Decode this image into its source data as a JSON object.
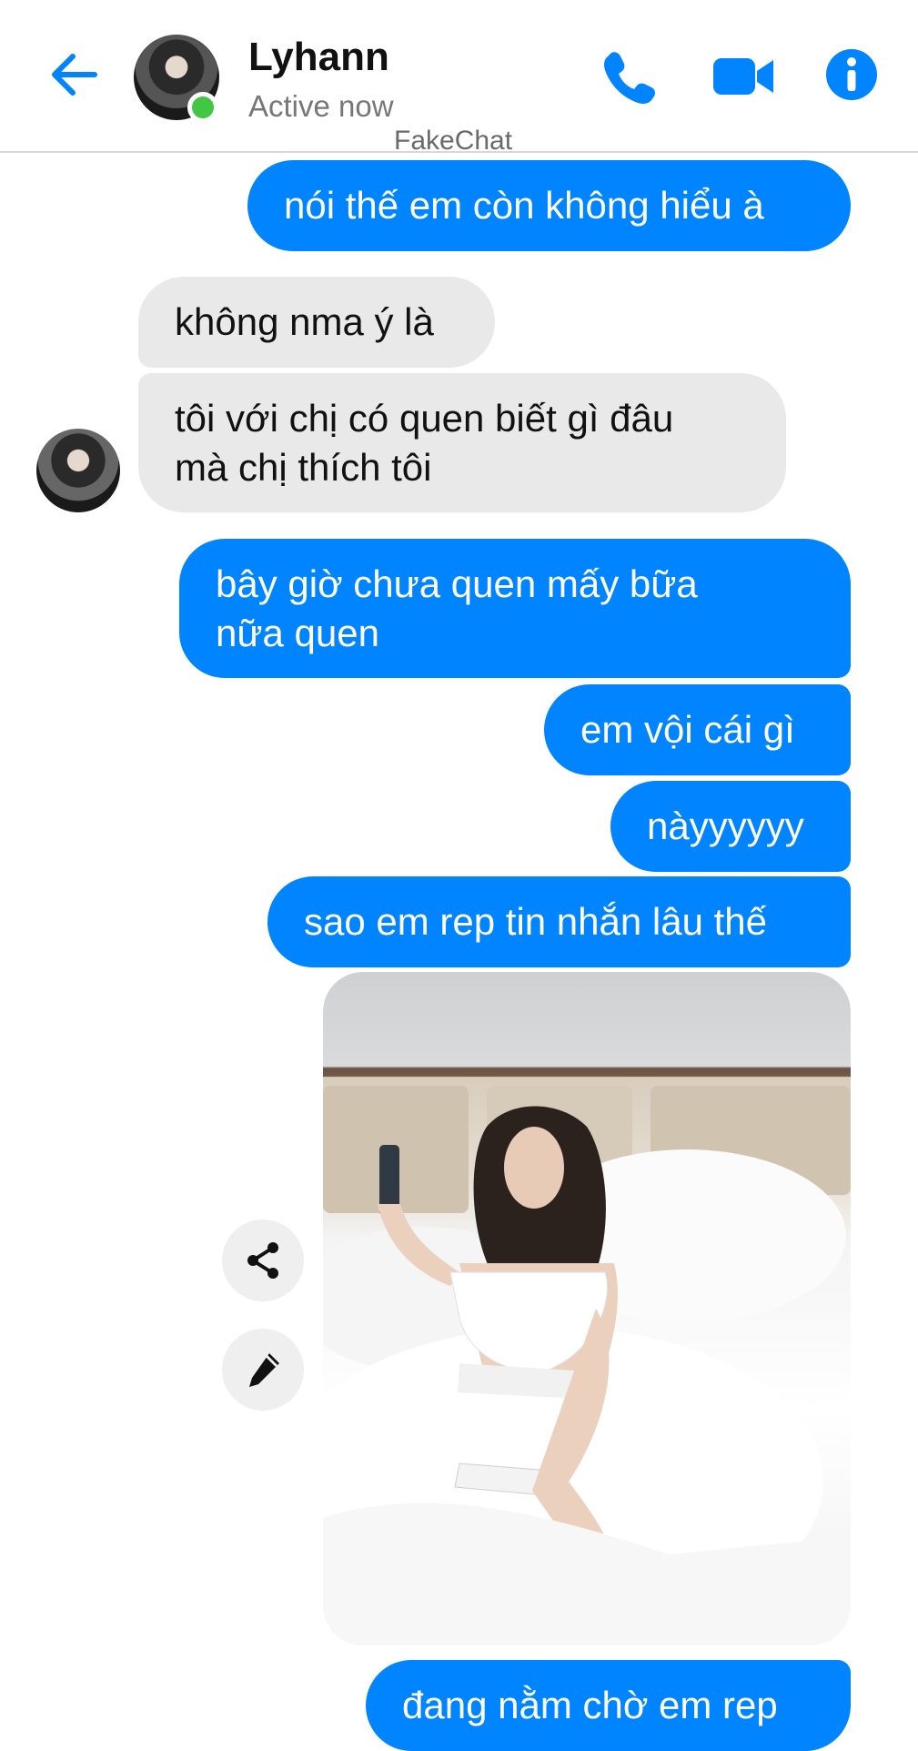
{
  "header": {
    "contact_name": "Lyhann",
    "status": "Active now",
    "watermark": "FakeChat",
    "icons": [
      "back-arrow-icon",
      "phone-icon",
      "video-camera-icon",
      "info-icon"
    ],
    "accent_color": "#0084ff",
    "online_color": "#42c644"
  },
  "messages": [
    {
      "side": "out",
      "text": "nói thế em còn không hiểu à"
    },
    {
      "side": "in",
      "text": "không nma ý là"
    },
    {
      "side": "in",
      "line1": "tôi với chị có quen biết gì đâu",
      "line2": "mà chị thích tôi"
    },
    {
      "side": "out",
      "line1": "bây giờ chưa quen mấy bữa",
      "line2": "nữa quen"
    },
    {
      "side": "out",
      "text": "em vội cái gì"
    },
    {
      "side": "out",
      "text": "nàyyyyyy"
    },
    {
      "side": "out",
      "text": "sao em rep tin nhắn lâu thế"
    },
    {
      "side": "out",
      "type": "photo"
    },
    {
      "side": "out",
      "text": "đang nằm chờ em rep"
    }
  ],
  "photo_actions": [
    "share-icon",
    "edit-pencil-icon"
  ],
  "colors": {
    "outgoing_bubble": "#0084ff",
    "incoming_bubble": "#e9e9e9"
  }
}
